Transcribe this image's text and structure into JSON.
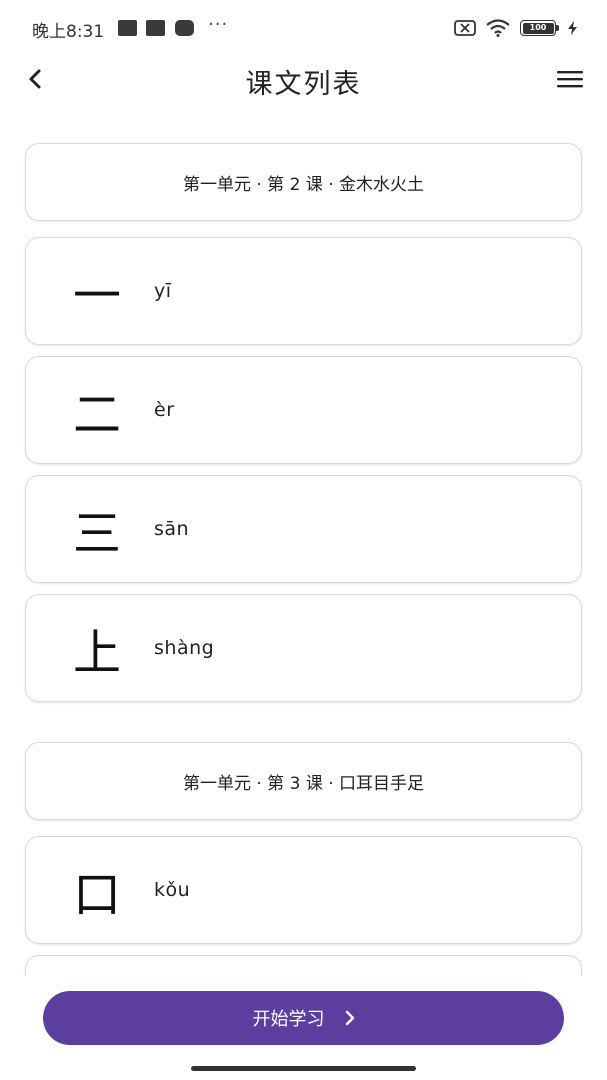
{
  "status_bar": {
    "time": "晚上8:31",
    "dots": "···",
    "battery": "100"
  },
  "header": {
    "title": "课文列表",
    "back_icon": "chevron-left-icon",
    "menu_icon": "hamburger-menu-icon"
  },
  "sections": [
    {
      "title": "第一单元 · 第 2 课 · 金木水火土",
      "items": [
        {
          "char": "一",
          "pinyin": "yī"
        },
        {
          "char": "二",
          "pinyin": "èr"
        },
        {
          "char": "三",
          "pinyin": "sān"
        },
        {
          "char": "上",
          "pinyin": "shàng"
        }
      ]
    },
    {
      "title": "第一单元 · 第 3 课 · 口耳目手足",
      "items": [
        {
          "char": "口",
          "pinyin": "kǒu"
        },
        {
          "char": "",
          "pinyin": ""
        }
      ]
    }
  ],
  "footer": {
    "start_label": "开始学习",
    "start_icon": "chevron-right-icon",
    "accent_color": "#5b3e9e"
  }
}
